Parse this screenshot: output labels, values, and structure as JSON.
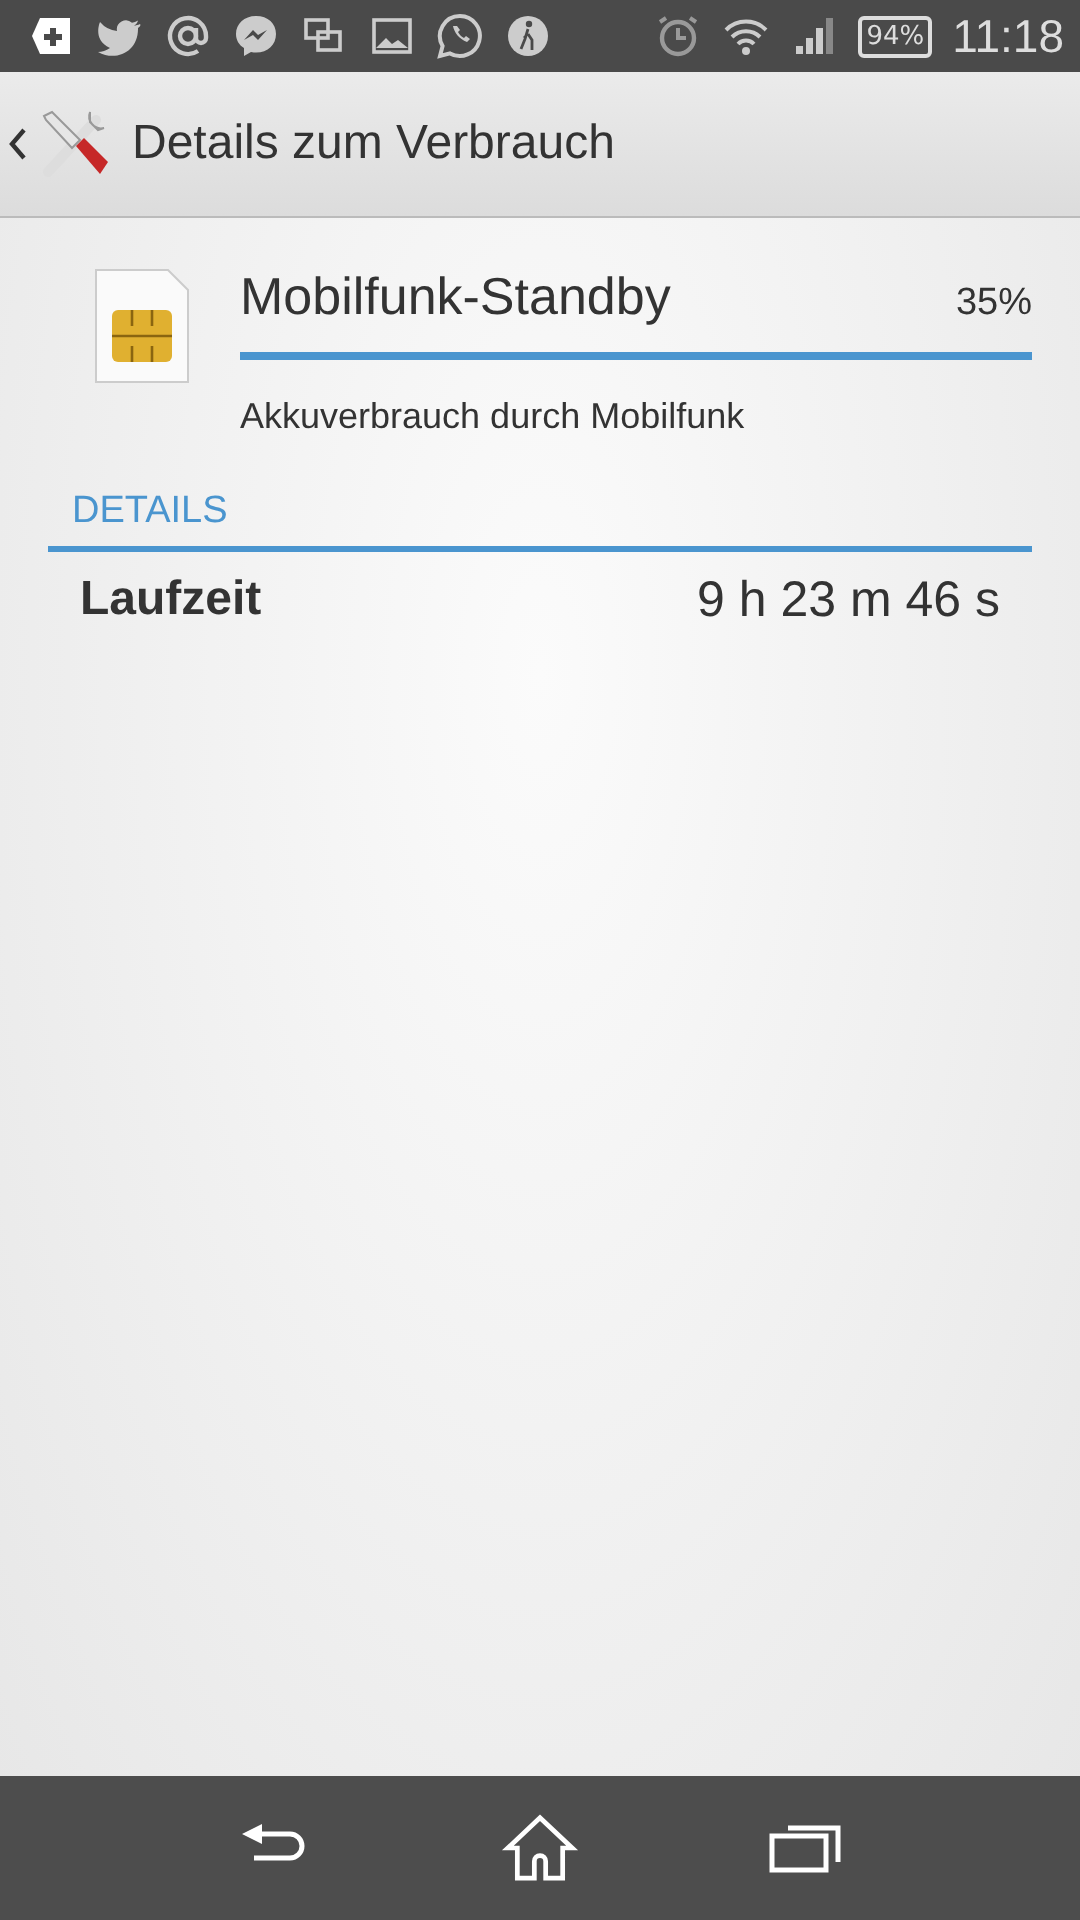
{
  "status_bar": {
    "battery": "94%",
    "time": "11:18"
  },
  "action_bar": {
    "title": "Details zum Verbrauch"
  },
  "usage": {
    "name": "Mobilfunk-Standby",
    "percent": "35%",
    "level": 1,
    "description": "Akkuverbrauch durch Mobilfunk"
  },
  "section": {
    "title": "DETAILS"
  },
  "details": [
    {
      "label": "Laufzeit",
      "value": "9 h 23 m 46 s"
    }
  ]
}
